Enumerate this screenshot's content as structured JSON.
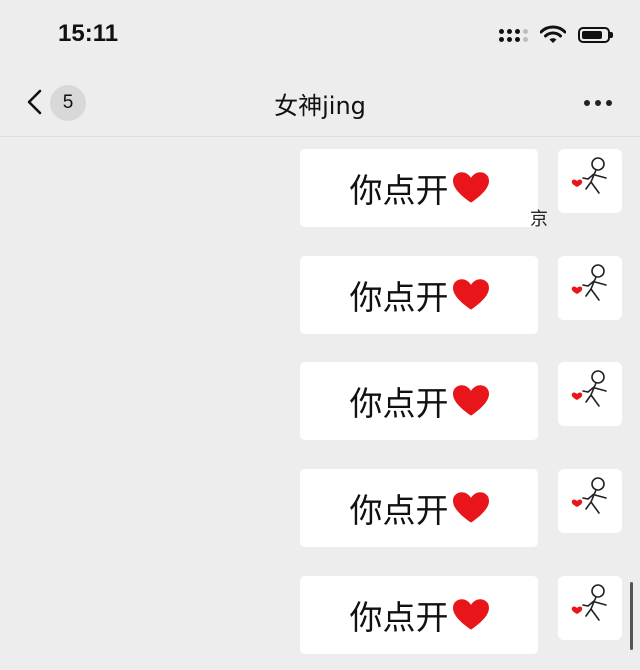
{
  "status_bar": {
    "time": "15:11",
    "icons": [
      "signal-icon",
      "wifi-icon",
      "battery-icon"
    ]
  },
  "nav": {
    "back_icon": "chevron-left-icon",
    "unread_count": "5",
    "title": "女神jing",
    "more_icon": "more-icon"
  },
  "messages": [
    {
      "text": "你点开",
      "emoji": "red-heart"
    },
    {
      "text": "你点开",
      "emoji": "red-heart"
    },
    {
      "text": "你点开",
      "emoji": "red-heart"
    },
    {
      "text": "你点开",
      "emoji": "red-heart"
    },
    {
      "text": "你点开",
      "emoji": "red-heart"
    }
  ],
  "side_char": "京",
  "colors": {
    "background": "#ededed",
    "bubble": "#ffffff",
    "heart": "#e8161b"
  }
}
